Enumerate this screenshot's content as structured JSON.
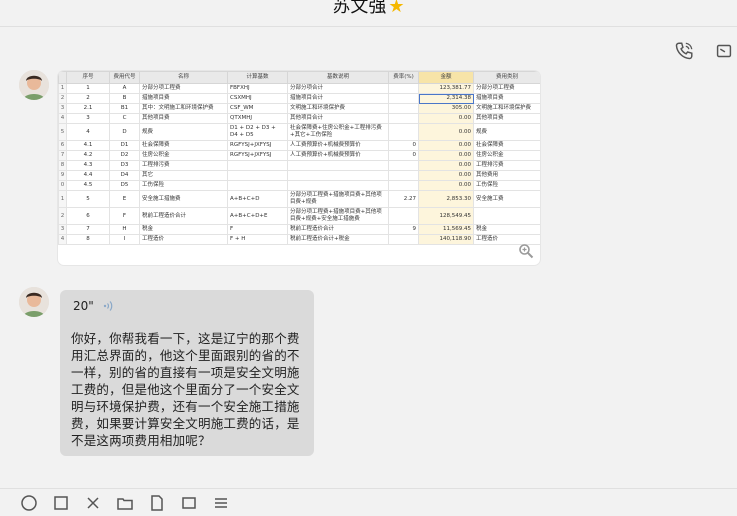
{
  "window": {
    "title": "苏文强"
  },
  "fee_table": {
    "headers": [
      "序号",
      "费用代号",
      "名称",
      "计算基数",
      "基数说明",
      "费率(%)",
      "金额",
      "费用类别"
    ],
    "rows": [
      [
        "1",
        "1",
        "A",
        "分部分项工程费",
        "FBFXHJ",
        "分部分项合计",
        "",
        "123,381.77",
        "分部分项工程费"
      ],
      [
        "2",
        "2",
        "B",
        "措施项目费",
        "CSXMHJ",
        "措施项目合计",
        "",
        "2,314.38",
        "措施项目费"
      ],
      [
        "3",
        "2.1",
        "B1",
        "其中：文明施工和环境保护费",
        "CSF_WM",
        "文明施工和环境保护费",
        "",
        "305.00",
        "文明施工和环境保护费"
      ],
      [
        "4",
        "3",
        "C",
        "其他项目费",
        "QTXMHJ",
        "其他项目合计",
        "",
        "0.00",
        "其他项目费"
      ],
      [
        "5",
        "4",
        "D",
        "规费",
        "D1 + D2 + D3 + D4 + D5",
        "社会保障费+住房公积金+工程排污费+其它+工伤保险",
        "",
        "0.00",
        "规费"
      ],
      [
        "6",
        "4.1",
        "D1",
        "社会保障费",
        "RGFYSJ+JXFYSJ",
        "人工费预算价+机械费预算价",
        "0",
        "0.00",
        "社会保障费"
      ],
      [
        "7",
        "4.2",
        "D2",
        "住房公积金",
        "RGFYSJ+JXFYSJ",
        "人工费预算价+机械费预算价",
        "0",
        "0.00",
        "住房公积金"
      ],
      [
        "8",
        "4.3",
        "D3",
        "工程排污费",
        "",
        "",
        "",
        "0.00",
        "工程排污费"
      ],
      [
        "9",
        "4.4",
        "D4",
        "其它",
        "",
        "",
        "",
        "0.00",
        "其他费用"
      ],
      [
        "0",
        "4.5",
        "D5",
        "工伤保险",
        "",
        "",
        "",
        "0.00",
        "工伤保险"
      ],
      [
        "1",
        "5",
        "E",
        "安全施工措施费",
        "A+B+C+D",
        "分部分项工程费+措施项目费+其他项目费+规费",
        "2.27",
        "2,853.30",
        "安全施工费"
      ],
      [
        "2",
        "6",
        "F",
        "税前工程造价合计",
        "A+B+C+D+E",
        "分部分项工程费+措施项目费+其他项目费+规费+安全施工措施费",
        "",
        "128,549.45",
        ""
      ],
      [
        "3",
        "7",
        "H",
        "税金",
        "F",
        "税前工程造价合计",
        "9",
        "11,569.45",
        "税金"
      ],
      [
        "4",
        "8",
        "I",
        "工程造价",
        "F + H",
        "税前工程造价合计+税金",
        "",
        "140,118.90",
        "工程造价"
      ]
    ]
  },
  "voice_message": {
    "duration": "20\""
  },
  "message_text": "你好，你帮我看一下，这是辽宁的那个费用汇总界面的，他这个里面跟别的省的不一样，别的省的直接有一项是安全文明施工费的，但是他这个里面分了一个安全文明与环境保护费，还有一个安全施工措施费，如果要计算安全文明施工费的话，是不是这两项费用相加呢？",
  "colors": {
    "bubble": "#dadada",
    "amount_header": "#f7e4a8",
    "star": "#f5b800"
  }
}
